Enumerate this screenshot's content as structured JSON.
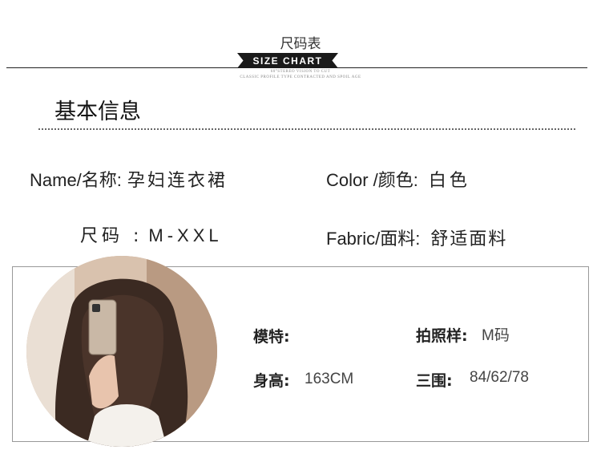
{
  "header": {
    "title": "尺码表",
    "banner": "SIZE CHART",
    "fine_line_1": "60°STEREO VISION TO CUT",
    "fine_line_2": "CLASSIC PROFILE TYPE CONTRACTED AND SPOIL AGE"
  },
  "section": {
    "title": "基本信息"
  },
  "info": {
    "name_label": "Name/名称:",
    "name_value": "孕妇连衣裙",
    "color_label": "Color /颜色:",
    "color_value": "白色",
    "size_label": "尺码 :",
    "size_value": "M-XXL",
    "fabric_label": "Fabric/面料:",
    "fabric_value": "舒适面料"
  },
  "model": {
    "model_label": "模特:",
    "model_value": "",
    "sample_label": "拍照样:",
    "sample_value": "M码",
    "height_label": "身高:",
    "height_value": "163CM",
    "measure_label": "三围:",
    "measure_value": "84/62/78"
  },
  "colors": {
    "text": "#222222",
    "banner": "#1a1a1a",
    "border": "#999999"
  }
}
